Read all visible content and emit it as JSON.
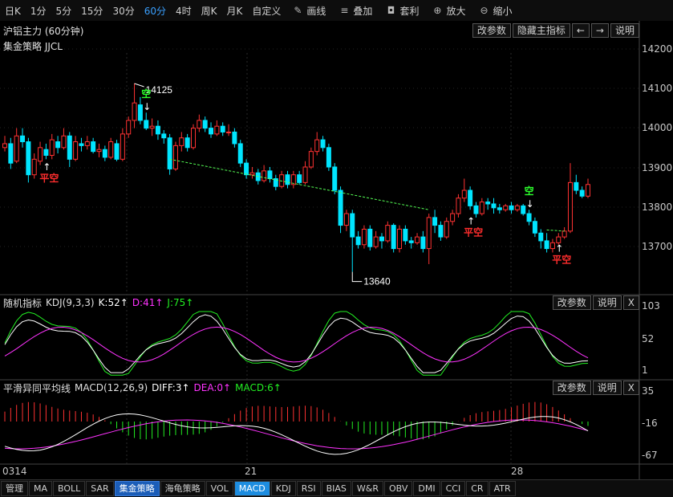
{
  "toolbar": {
    "periods": [
      "日K",
      "1分",
      "5分",
      "15分",
      "30分",
      "60分",
      "4时",
      "周K",
      "月K",
      "自定义"
    ],
    "active_period": "60分",
    "tools": [
      {
        "label": "画线",
        "icon": "pencil-icon"
      },
      {
        "label": "叠加",
        "icon": "stack-icon"
      },
      {
        "label": "套利",
        "icon": "bag-icon"
      },
      {
        "label": "放大",
        "icon": "zoom-in-icon"
      },
      {
        "label": "缩小",
        "icon": "zoom-out-icon"
      }
    ]
  },
  "main_panel": {
    "title": "沪铝主力 (60分钟)",
    "strategy": "集金策略 JJCL",
    "buttons": {
      "edit": "改参数",
      "hide": "隐藏主指标",
      "prev": "←",
      "next": "→",
      "help": "说明"
    },
    "y_ticks": [
      "14200",
      "14100",
      "14000",
      "13900",
      "13800",
      "13700"
    ],
    "high_label": "14125",
    "low_label": "13640",
    "signals": [
      {
        "text": "平空",
        "color": "#ff2d2d"
      },
      {
        "text": "空",
        "color": "#2cff2c"
      },
      {
        "text": "平空",
        "color": "#ff2d2d"
      },
      {
        "text": "空",
        "color": "#2cff2c"
      },
      {
        "text": "平空",
        "color": "#ff2d2d"
      }
    ]
  },
  "kdj_panel": {
    "name": "随机指标",
    "label": "KDJ(9,3,3)",
    "k": "K:52↑",
    "d": "D:41↑",
    "j": "J:75↑",
    "buttons": {
      "edit": "改参数",
      "help": "说明",
      "close": "X"
    },
    "y_ticks": [
      "103",
      "52",
      "1"
    ]
  },
  "macd_panel": {
    "name": "平滑异同平均线",
    "label": "MACD(12,26,9)",
    "diff": "DIFF:3↑",
    "dea": "DEA:0↑",
    "macd": "MACD:6↑",
    "buttons": {
      "edit": "改参数",
      "help": "说明",
      "close": "X"
    },
    "y_ticks": [
      "35",
      "-16",
      "-67"
    ]
  },
  "x_axis": [
    "0314",
    "21",
    "28"
  ],
  "bottom_tabs": [
    "管理",
    "MA",
    "BOLL",
    "SAR",
    "集金策略",
    "海龟策略",
    "VOL",
    "MACD",
    "KDJ",
    "RSI",
    "BIAS",
    "W&R",
    "OBV",
    "DMI",
    "CCI",
    "CR",
    "ATR"
  ],
  "colors": {
    "up": "#ff3232",
    "down": "#00e5ff",
    "trend": "#55ff55",
    "k": "#ffffff",
    "d": "#ff33ff",
    "j": "#22ee22"
  },
  "chart_data": {
    "type": "candlestick",
    "y_range": [
      13600,
      14230
    ],
    "candles": [
      [
        13960,
        13970,
        13990,
        13950
      ],
      [
        13970,
        13920,
        13985,
        13905
      ],
      [
        13925,
        13990,
        14010,
        13920
      ],
      [
        13990,
        13975,
        14010,
        13960
      ],
      [
        13975,
        13890,
        13985,
        13870
      ],
      [
        13890,
        13930,
        13945,
        13880
      ],
      [
        13925,
        13960,
        13975,
        13915
      ],
      [
        13955,
        13940,
        13970,
        13930
      ],
      [
        13940,
        13980,
        13995,
        13930
      ],
      [
        13975,
        13960,
        13990,
        13945
      ],
      [
        13960,
        13990,
        14010,
        13955
      ],
      [
        13990,
        13930,
        14000,
        13910
      ],
      [
        13930,
        13975,
        13990,
        13925
      ],
      [
        13970,
        13965,
        13985,
        13950
      ],
      [
        13965,
        13975,
        13990,
        13955
      ],
      [
        13975,
        13950,
        13985,
        13945
      ],
      [
        13950,
        13955,
        13970,
        13935
      ],
      [
        13955,
        13935,
        13965,
        13925
      ],
      [
        13935,
        13975,
        13985,
        13930
      ],
      [
        13970,
        13930,
        13980,
        13925
      ],
      [
        13930,
        13995,
        14010,
        13925
      ],
      [
        13995,
        14030,
        14040,
        13985
      ],
      [
        14030,
        14075,
        14125,
        14010
      ],
      [
        14070,
        14030,
        14090,
        14020
      ],
      [
        14030,
        14010,
        14050,
        14005
      ],
      [
        14010,
        14015,
        14035,
        13990
      ],
      [
        14015,
        13995,
        14030,
        13980
      ],
      [
        13995,
        13985,
        14005,
        13970
      ],
      [
        13985,
        13905,
        13995,
        13890
      ],
      [
        13905,
        13965,
        13975,
        13900
      ],
      [
        13965,
        13985,
        14000,
        13950
      ],
      [
        13985,
        13960,
        13995,
        13950
      ],
      [
        13960,
        14010,
        14020,
        13955
      ],
      [
        14010,
        14030,
        14045,
        14000
      ],
      [
        14030,
        14010,
        14040,
        14000
      ],
      [
        14010,
        13995,
        14025,
        13985
      ],
      [
        13995,
        14015,
        14030,
        13990
      ],
      [
        14015,
        14000,
        14025,
        13990
      ],
      [
        14000,
        14000,
        14020,
        13990
      ],
      [
        14000,
        13970,
        14010,
        13960
      ],
      [
        13970,
        13920,
        13980,
        13910
      ],
      [
        13920,
        13890,
        13930,
        13880
      ],
      [
        13890,
        13895,
        13910,
        13880
      ],
      [
        13895,
        13875,
        13905,
        13865
      ],
      [
        13875,
        13900,
        13915,
        13870
      ],
      [
        13900,
        13880,
        13910,
        13870
      ],
      [
        13880,
        13860,
        13890,
        13850
      ],
      [
        13860,
        13890,
        13900,
        13855
      ],
      [
        13890,
        13865,
        13900,
        13855
      ],
      [
        13865,
        13890,
        13900,
        13855
      ],
      [
        13890,
        13870,
        13900,
        13865
      ],
      [
        13870,
        13910,
        13925,
        13865
      ],
      [
        13910,
        13950,
        13960,
        13905
      ],
      [
        13950,
        13980,
        14000,
        13940
      ],
      [
        13980,
        13960,
        13990,
        13950
      ],
      [
        13960,
        13910,
        13970,
        13900
      ],
      [
        13910,
        13850,
        13920,
        13840
      ],
      [
        13850,
        13760,
        13860,
        13740
      ],
      [
        13760,
        13790,
        13800,
        13745
      ],
      [
        13790,
        13730,
        13800,
        13640
      ],
      [
        13730,
        13710,
        13745,
        13700
      ],
      [
        13710,
        13750,
        13760,
        13700
      ],
      [
        13750,
        13705,
        13760,
        13695
      ],
      [
        13705,
        13730,
        13745,
        13700
      ],
      [
        13730,
        13720,
        13740,
        13700
      ],
      [
        13720,
        13760,
        13770,
        13715
      ],
      [
        13760,
        13700,
        13765,
        13690
      ],
      [
        13700,
        13750,
        13760,
        13690
      ],
      [
        13750,
        13720,
        13760,
        13710
      ],
      [
        13720,
        13715,
        13730,
        13700
      ],
      [
        13715,
        13730,
        13740,
        13710
      ],
      [
        13730,
        13700,
        13745,
        13690
      ],
      [
        13700,
        13780,
        13790,
        13660
      ],
      [
        13780,
        13760,
        13800,
        13740
      ],
      [
        13760,
        13730,
        13770,
        13720
      ],
      [
        13730,
        13770,
        13780,
        13725
      ],
      [
        13770,
        13790,
        13800,
        13760
      ],
      [
        13790,
        13830,
        13840,
        13780
      ],
      [
        13830,
        13850,
        13880,
        13820
      ],
      [
        13850,
        13810,
        13860,
        13800
      ],
      [
        13810,
        13790,
        13820,
        13780
      ],
      [
        13790,
        13820,
        13830,
        13785
      ],
      [
        13820,
        13815,
        13830,
        13800
      ],
      [
        13815,
        13805,
        13830,
        13790
      ],
      [
        13805,
        13800,
        13815,
        13790
      ],
      [
        13800,
        13810,
        13815,
        13795
      ],
      [
        13810,
        13800,
        13820,
        13790
      ],
      [
        13800,
        13810,
        13815,
        13795
      ],
      [
        13810,
        13790,
        13815,
        13785
      ],
      [
        13790,
        13770,
        13800,
        13760
      ],
      [
        13770,
        13740,
        13780,
        13730
      ],
      [
        13740,
        13720,
        13750,
        13700
      ],
      [
        13720,
        13700,
        13740,
        13690
      ],
      [
        13700,
        13715,
        13725,
        13690
      ],
      [
        13715,
        13730,
        13740,
        13710
      ],
      [
        13730,
        13745,
        13755,
        13725
      ],
      [
        13745,
        13870,
        13920,
        13740
      ],
      [
        13870,
        13850,
        13890,
        13840
      ],
      [
        13850,
        13835,
        13860,
        13830
      ],
      [
        13835,
        13865,
        13880,
        13830
      ]
    ]
  }
}
